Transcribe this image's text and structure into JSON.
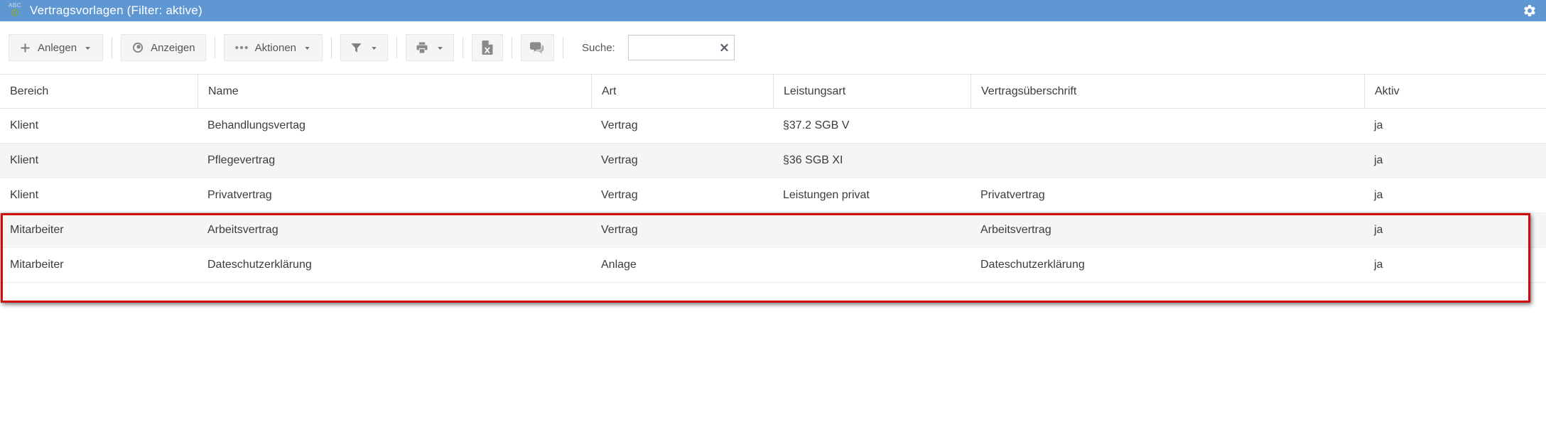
{
  "title_bar": {
    "title": "Vertragsvorlagen (Filter: aktive)",
    "app_icon_text": "ABC"
  },
  "toolbar": {
    "buttons": {
      "anlegen": "Anlegen",
      "anzeigen": "Anzeigen",
      "aktionen": "Aktionen"
    },
    "search": {
      "label": "Suche:",
      "value": ""
    }
  },
  "table": {
    "columns": [
      "Bereich",
      "Name",
      "Art",
      "Leistungsart",
      "Vertragsüberschrift",
      "Aktiv"
    ],
    "rows": [
      [
        "Klient",
        "Behandlungsvertag",
        "Vertrag",
        "§37.2 SGB V",
        "",
        "ja"
      ],
      [
        "Klient",
        "Pflegevertrag",
        "Vertrag",
        "§36 SGB XI",
        "",
        "ja"
      ],
      [
        "Klient",
        "Privatvertrag",
        "Vertrag",
        "Leistungen privat",
        "Privatvertrag",
        "ja"
      ],
      [
        "Mitarbeiter",
        "Arbeitsvertrag",
        "Vertrag",
        "",
        "Arbeitsvertrag",
        "ja"
      ],
      [
        "Mitarbeiter",
        "Dateschutzerklärung",
        "Anlage",
        "",
        "Dateschutzerklärung",
        "ja"
      ]
    ]
  },
  "colors": {
    "titlebar_blue": "#5f97d3",
    "highlight_red": "#d10b0b",
    "row_alt_gray": "#f5f5f5"
  }
}
